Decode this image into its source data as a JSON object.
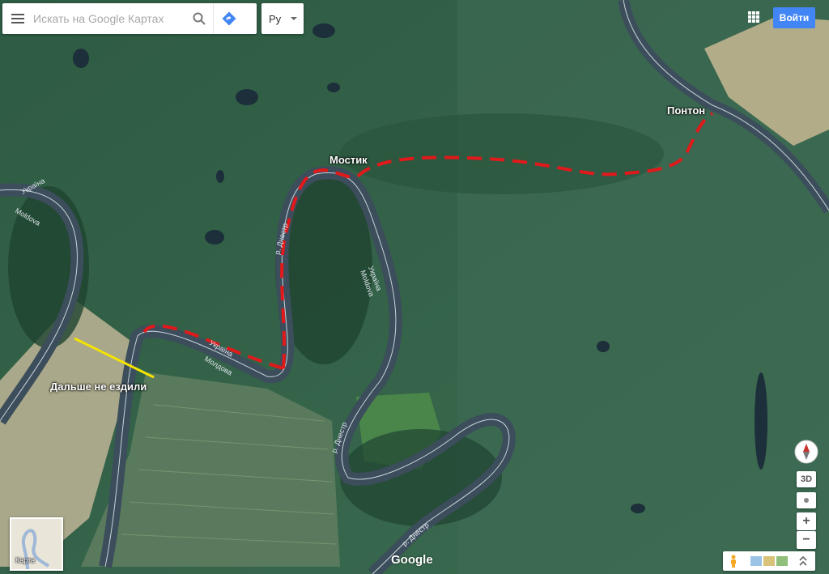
{
  "search": {
    "placeholder": "Искать на Google Картах"
  },
  "language": {
    "label": "Ру"
  },
  "header": {
    "signin_label": "Войти"
  },
  "annotations": {
    "bridge": "Мостик",
    "pontoon": "Понтон",
    "stop": "Дальше не ездили"
  },
  "river_labels": {
    "ukraine_1": "Україна",
    "moldova_1": "Moldova",
    "ukraine_2": "Україна",
    "moldova_2": "Молдова",
    "ukraine_3": "Україна",
    "moldova_3": "Moldova",
    "dniester_1": "р. Днестр",
    "dniester_2": "р. Днестр",
    "dniester_3": "р. Днестр"
  },
  "controls": {
    "view_3d": "3D",
    "zoom_in": "+",
    "zoom_out": "−"
  },
  "minimap": {
    "label": "Карта"
  },
  "branding": {
    "logo": "Google"
  },
  "icons": {
    "menu": "menu-icon",
    "search": "search-icon",
    "directions": "directions-icon",
    "apps": "apps-grid-icon",
    "compass": "compass-icon",
    "pegman": "pegman-icon",
    "layers": "imagery-icon",
    "expand": "expand-icon"
  },
  "colors": {
    "route": "#e0191b",
    "stop_line": "#f4e400",
    "signin": "#4285f4",
    "river": "#3c4d5b"
  }
}
